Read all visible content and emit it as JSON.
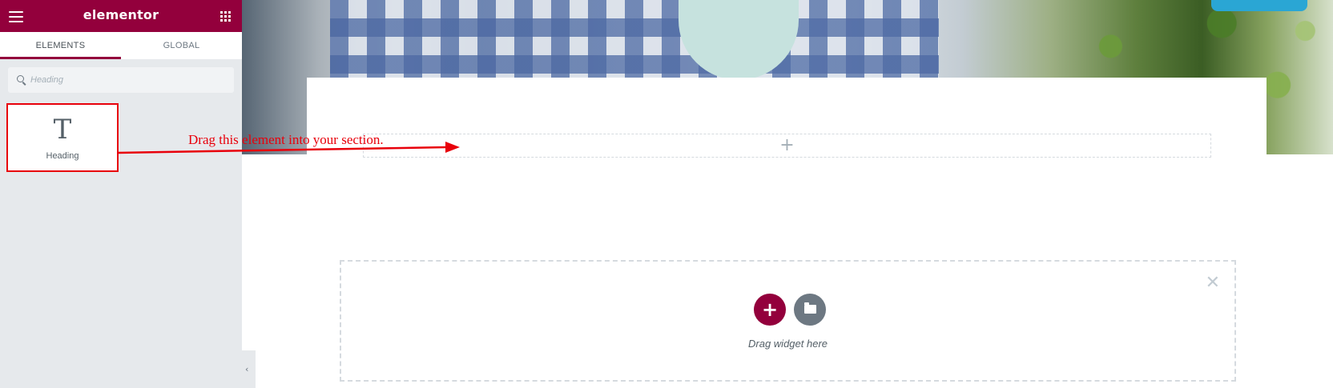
{
  "app": {
    "logo": "elementor"
  },
  "tabs": [
    {
      "label": "ELEMENTS"
    },
    {
      "label": "GLOBAL"
    }
  ],
  "search": {
    "placeholder": "Heading"
  },
  "widgets": [
    {
      "label": "Heading",
      "icon": "heading-T-icon"
    }
  ],
  "annotation": {
    "text": "Drag this element into your section."
  },
  "drop_zone": {
    "hint": "Drag widget here"
  },
  "colors": {
    "brand": "#93003c",
    "annotation": "#e8000b",
    "secondary": "#6d7882"
  },
  "icons": [
    "hamburger-icon",
    "apps-grid-icon",
    "search-icon",
    "heading-T-icon",
    "plus-icon",
    "close-icon",
    "folder-icon",
    "chevron-left-icon"
  ]
}
